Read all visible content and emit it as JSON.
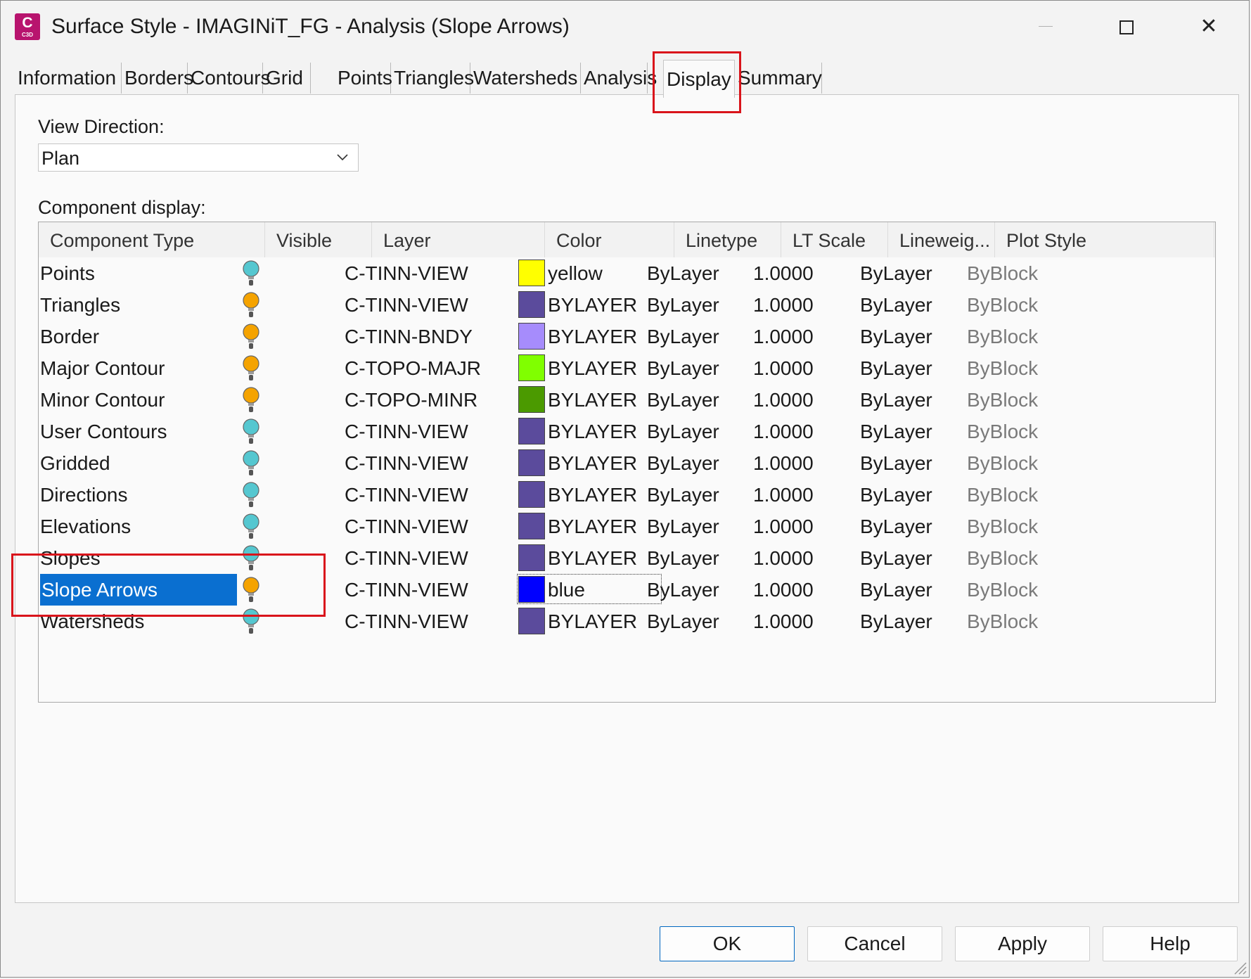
{
  "window": {
    "title": "Surface Style - IMAGINiT_FG - Analysis (Slope Arrows)",
    "app_icon_letter": "C",
    "app_icon_sub": "C3D",
    "close_glyph": "✕"
  },
  "tabs": [
    {
      "label": "Information"
    },
    {
      "label": "Borders"
    },
    {
      "label": "Contours"
    },
    {
      "label": "Grid"
    },
    {
      "label": "Points"
    },
    {
      "label": "Triangles"
    },
    {
      "label": "Watersheds"
    },
    {
      "label": "Analysis"
    },
    {
      "label": "Display",
      "active": true
    },
    {
      "label": "Summary"
    }
  ],
  "view_direction": {
    "label": "View Direction:",
    "value": "Plan"
  },
  "component_display": {
    "label": "Component display:",
    "columns": [
      "Component Type",
      "Visible",
      "Layer",
      "Color",
      "Linetype",
      "LT Scale",
      "Lineweig...",
      "Plot Style"
    ],
    "rows": [
      {
        "type": "Points",
        "visible": "off",
        "layer": "C-TINN-VIEW",
        "color": "yellow",
        "swatch": "#ffff00",
        "linetype": "ByLayer",
        "lt_scale": "1.0000",
        "lineweight": "ByLayer",
        "plot_style": "ByBlock"
      },
      {
        "type": "Triangles",
        "visible": "on",
        "layer": "C-TINN-VIEW",
        "color": "BYLAYER",
        "swatch": "#5b4b9c",
        "linetype": "ByLayer",
        "lt_scale": "1.0000",
        "lineweight": "ByLayer",
        "plot_style": "ByBlock"
      },
      {
        "type": "Border",
        "visible": "on",
        "layer": "C-TINN-BNDY",
        "color": "BYLAYER",
        "swatch": "#a68cfc",
        "linetype": "ByLayer",
        "lt_scale": "1.0000",
        "lineweight": "ByLayer",
        "plot_style": "ByBlock"
      },
      {
        "type": "Major Contour",
        "visible": "on",
        "layer": "C-TOPO-MAJR",
        "color": "BYLAYER",
        "swatch": "#80ff00",
        "linetype": "ByLayer",
        "lt_scale": "1.0000",
        "lineweight": "ByLayer",
        "plot_style": "ByBlock"
      },
      {
        "type": "Minor Contour",
        "visible": "on",
        "layer": "C-TOPO-MINR",
        "color": "BYLAYER",
        "swatch": "#4b9a00",
        "linetype": "ByLayer",
        "lt_scale": "1.0000",
        "lineweight": "ByLayer",
        "plot_style": "ByBlock"
      },
      {
        "type": "User Contours",
        "visible": "off",
        "layer": "C-TINN-VIEW",
        "color": "BYLAYER",
        "swatch": "#5b4b9c",
        "linetype": "ByLayer",
        "lt_scale": "1.0000",
        "lineweight": "ByLayer",
        "plot_style": "ByBlock"
      },
      {
        "type": "Gridded",
        "visible": "off",
        "layer": "C-TINN-VIEW",
        "color": "BYLAYER",
        "swatch": "#5b4b9c",
        "linetype": "ByLayer",
        "lt_scale": "1.0000",
        "lineweight": "ByLayer",
        "plot_style": "ByBlock"
      },
      {
        "type": "Directions",
        "visible": "off",
        "layer": "C-TINN-VIEW",
        "color": "BYLAYER",
        "swatch": "#5b4b9c",
        "linetype": "ByLayer",
        "lt_scale": "1.0000",
        "lineweight": "ByLayer",
        "plot_style": "ByBlock"
      },
      {
        "type": "Elevations",
        "visible": "off",
        "layer": "C-TINN-VIEW",
        "color": "BYLAYER",
        "swatch": "#5b4b9c",
        "linetype": "ByLayer",
        "lt_scale": "1.0000",
        "lineweight": "ByLayer",
        "plot_style": "ByBlock"
      },
      {
        "type": "Slopes",
        "visible": "off",
        "layer": "C-TINN-VIEW",
        "color": "BYLAYER",
        "swatch": "#5b4b9c",
        "linetype": "ByLayer",
        "lt_scale": "1.0000",
        "lineweight": "ByLayer",
        "plot_style": "ByBlock"
      },
      {
        "type": "Slope Arrows",
        "visible": "on",
        "layer": "C-TINN-VIEW",
        "color": "blue",
        "swatch": "#0000ff",
        "linetype": "ByLayer",
        "lt_scale": "1.0000",
        "lineweight": "ByLayer",
        "plot_style": "ByBlock",
        "selected": true
      },
      {
        "type": "Watersheds",
        "visible": "off",
        "layer": "C-TINN-VIEW",
        "color": "BYLAYER",
        "swatch": "#5b4b9c",
        "linetype": "ByLayer",
        "lt_scale": "1.0000",
        "lineweight": "ByLayer",
        "plot_style": "ByBlock"
      }
    ]
  },
  "buttons": {
    "ok": "OK",
    "cancel": "Cancel",
    "apply": "Apply",
    "help": "Help"
  },
  "colors": {
    "bulb_on": "#f5a300",
    "bulb_off": "#55c7d0",
    "selection": "#0a6fd0",
    "highlight": "#d9141b"
  },
  "icons": [
    "app-icon",
    "minimize-icon",
    "maximize-icon",
    "close-icon",
    "chevron-down-icon",
    "lightbulb-icon",
    "resize-grip-icon"
  ]
}
